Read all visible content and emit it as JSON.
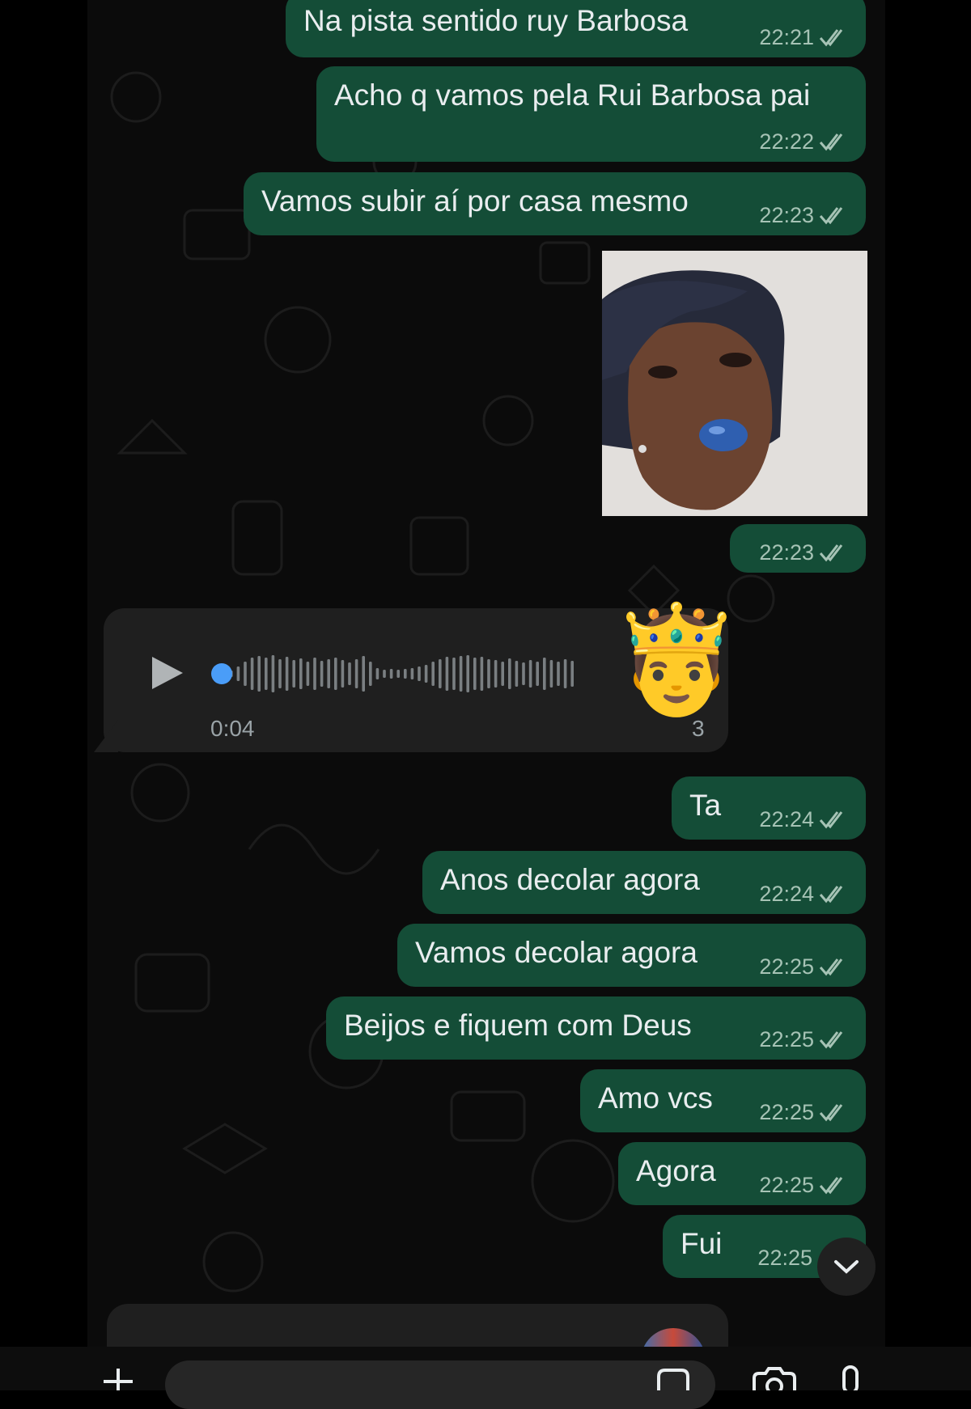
{
  "messages": [
    {
      "text": "Na pista sentido ruy Barbosa",
      "time": "22:21"
    },
    {
      "text": "Acho q vamos pela Rui Barbosa pai",
      "time": "22:22"
    },
    {
      "text": "Vamos subir aí por casa mesmo",
      "time": "22:23"
    },
    {
      "image_time": "22:23"
    },
    {
      "text": "Ta",
      "time": "22:24"
    },
    {
      "text": "Anos decolar agora",
      "time": "22:24"
    },
    {
      "text": "Vamos decolar agora",
      "time": "22:25"
    },
    {
      "text": "Beijos e fiquem com Deus",
      "time": "22:25"
    },
    {
      "text": "Amo vcs",
      "time": "22:25"
    },
    {
      "text": "Agora",
      "time": "22:25"
    },
    {
      "text": "Fui",
      "time": "22:25"
    }
  ],
  "voice_message": {
    "duration": "0:04",
    "time_partial": "3",
    "emoji": "🤴",
    "play_icon": "play-icon",
    "progress": 0.0
  },
  "icons": {
    "read_ticks": "double-check-icon",
    "scroll_down": "chevron-down-icon",
    "attach": "plus-icon",
    "sticker": "sticker-icon",
    "camera": "camera-icon",
    "mic": "mic-icon"
  },
  "colors": {
    "outgoing_bubble": "#144d37",
    "incoming_bubble": "#1f1f1f",
    "background": "#0b0b0b",
    "voice_dot": "#4a9df8"
  }
}
